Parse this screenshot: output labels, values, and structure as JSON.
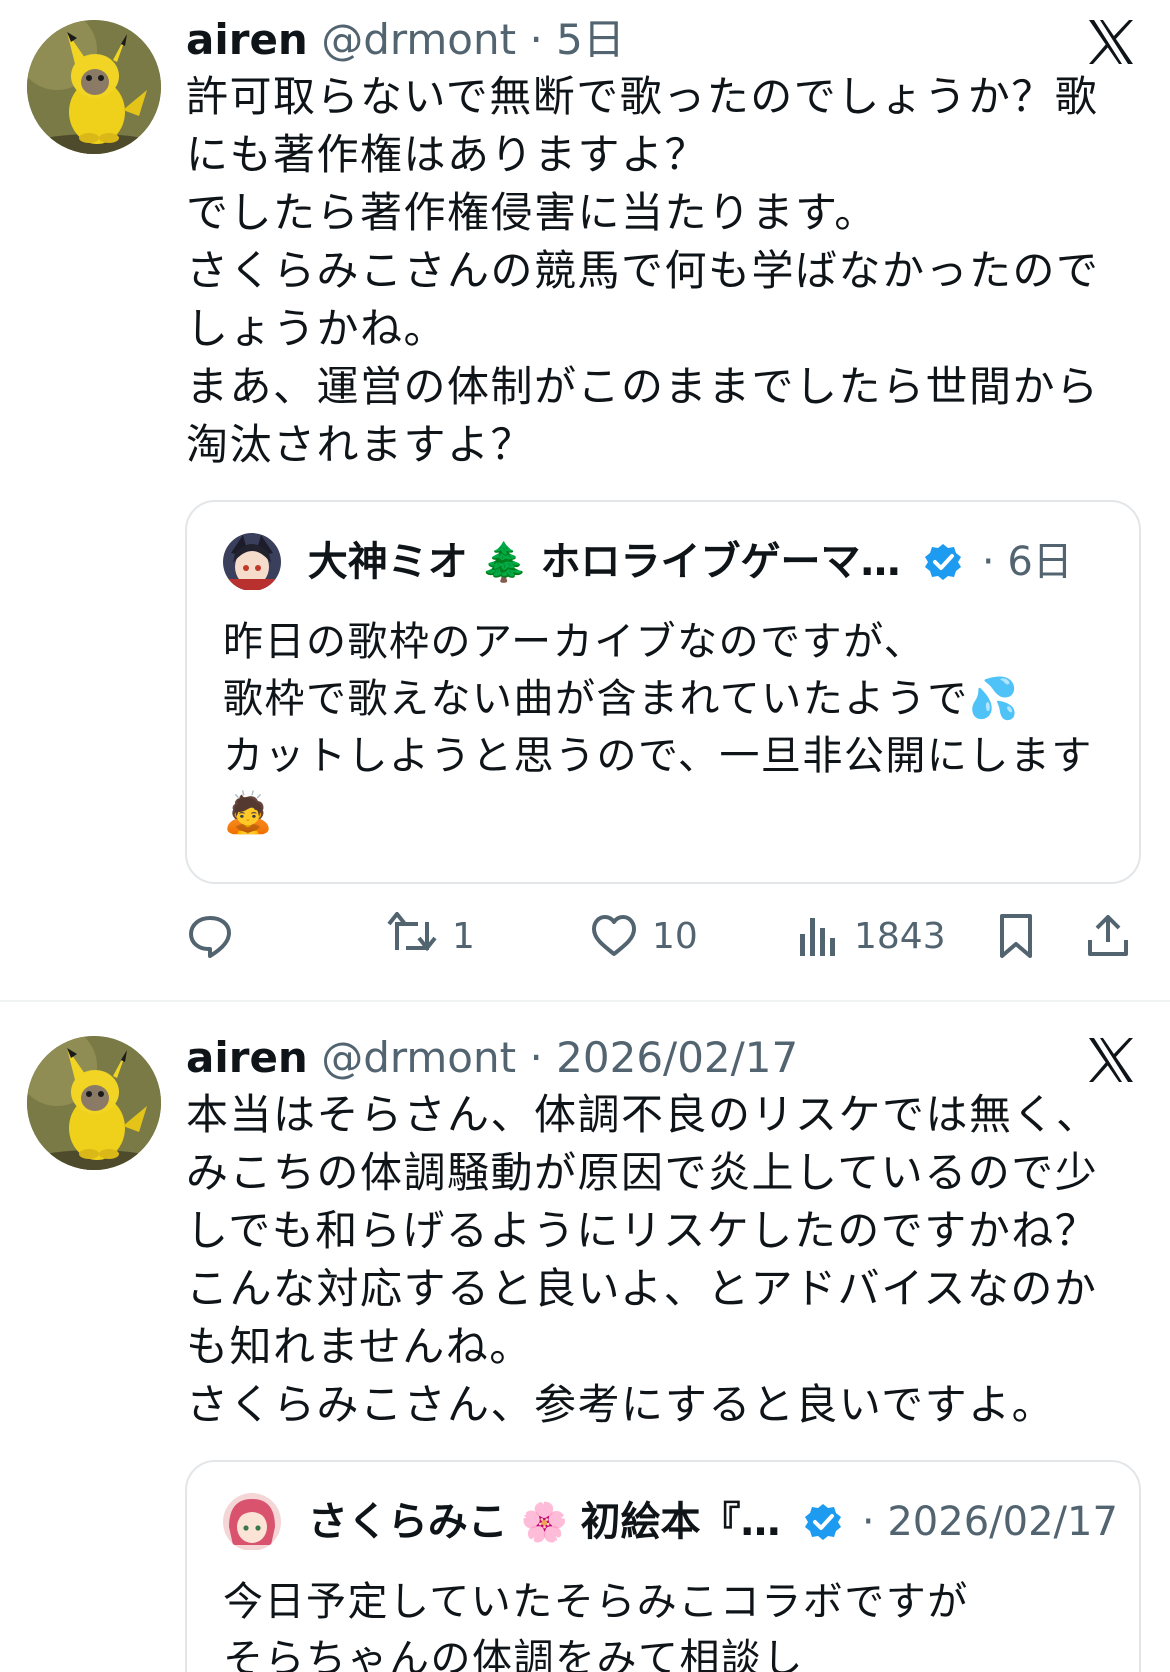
{
  "tweets": [
    {
      "name": "airen",
      "handle": "@drmont",
      "dot": "·",
      "time": "5日",
      "text": "許可取らないで無断で歌ったのでしょうか？歌にも著作権はありますよ？\nでしたら著作権侵害に当たります。\nさくらみこさんの競馬で何も学ばなかったのでしょうかね。\nまあ、運営の体制がこのままでしたら世間から淘汰されますよ？",
      "quote": {
        "name": "大神ミオ",
        "name_emoji": "🌲",
        "name_rest": "ホロライブゲーマ…",
        "dot": "·",
        "time": "6日",
        "text": "昨日の歌枠のアーカイブなのですが、\n歌枠で歌えない曲が含まれていたようで💦\nカットしようと思うので、一旦非公開にします🙇"
      },
      "actions": {
        "reply_count": "",
        "retweet_count": "1",
        "like_count": "10",
        "view_count": "1843"
      }
    },
    {
      "name": "airen",
      "handle": "@drmont",
      "dot": "·",
      "time": "2026/02/17",
      "text": "本当はそらさん、体調不良のリスケでは無く、みこちの体調騒動が原因で炎上しているので少しでも和らげるようにリスケしたのですかね？\nこんな対応すると良いよ、とアドバイスなのかも知れませんね。\nさくらみこさん、参考にすると良いですよ。",
      "quote": {
        "name": "さくらみこ",
        "name_emoji": "🌸",
        "name_rest": "初絵本『…",
        "dot": "·",
        "time": "2026/02/17",
        "text": "今日予定していたそらみこコラボですが\nそらちゃんの体調をみて相談し"
      }
    }
  ],
  "colors": {
    "text": "#0f1419",
    "secondary": "#536471",
    "verified": "#1d9bf0",
    "border": "#e3e6e8"
  },
  "icons": [
    "x-logo-icon",
    "verified-badge-icon",
    "reply-icon",
    "retweet-icon",
    "like-icon",
    "views-icon",
    "bookmark-icon",
    "share-icon"
  ]
}
